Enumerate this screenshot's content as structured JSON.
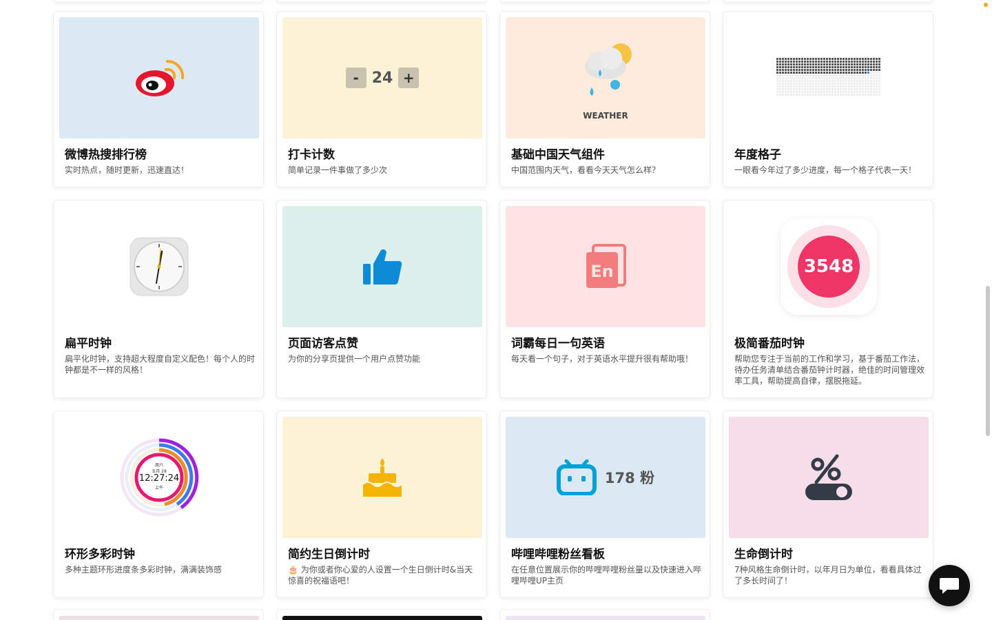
{
  "colors": {
    "weibo_bg": "#dbeaf2",
    "counter_bg": "#fcf3d6",
    "weather_bg": "#fdebdc",
    "mint_bg": "#dcefeb",
    "pink_bg": "#fde3e3",
    "rose_bg": "#f7dde8",
    "blue_bg": "#dbeaf2",
    "accent_blue": "#00a1d6",
    "accent_yellow": "#ffc107",
    "accent_red": "#ee3566"
  },
  "cards": [
    {
      "title": "微博热搜排行榜",
      "desc": "实时热点，随时更新，迅速直达！",
      "icon": "weibo-logo-icon"
    },
    {
      "title": "打卡计数",
      "desc": "简单记录一件事做了多少次",
      "icon": "counter-icon"
    },
    {
      "title": "基础中国天气组件",
      "desc": "中国范围内天气，看看今天天气怎么样？",
      "icon": "weather-icon"
    },
    {
      "title": "年度格子",
      "desc": "一眼看今年过了多少进度，每一个格子代表一天！",
      "icon": "year-grid-icon"
    },
    {
      "title": "扁平时钟",
      "desc": "扁平化时钟，支持超大程度自定义配色！每个人的时钟都是不一样的风格！",
      "icon": "clock-icon"
    },
    {
      "title": "页面访客点赞",
      "desc": "为你的分享页提供一个用户点赞功能",
      "icon": "thumbs-up-icon"
    },
    {
      "title": "词霸每日一句英语",
      "desc": "每天看一个句子，对于英语水平提升很有帮助哦！",
      "icon": "english-book-icon"
    },
    {
      "title": "极简番茄时钟",
      "desc": "帮助您专注于当前的工作和学习，基于番茄工作法，待办任务清单结合番茄钟计时器，绝佳的时间管理效率工具，帮助提高自律，摆脱拖延。",
      "icon": "pomodoro-icon"
    },
    {
      "title": "环形多彩时钟",
      "desc": "多种主题环形进度条多彩时钟，满满装饰感",
      "icon": "ring-clock-icon"
    },
    {
      "title": "简约生日倒计时",
      "desc": "🎂 为你或者你心爱的人设置一个生日倒计时&当天惊喜的祝福语吧！",
      "icon": "birthday-cake-icon"
    },
    {
      "title": "哔哩哔哩粉丝看板",
      "desc": "在任意位置展示你的哔哩哔哩粉丝量以及快速进入哔哩哔哩UP主页",
      "icon": "bilibili-icon"
    },
    {
      "title": "生命倒计时",
      "desc": "7种风格生命倒计时，以年月日为单位，看看具体过了多长时间了！",
      "icon": "percent-toggle-icon"
    }
  ],
  "widgets": {
    "counter": {
      "minus": "-",
      "value": "24",
      "plus": "+"
    },
    "weather_label": "WEATHER",
    "pomodoro_value": "3548",
    "ring_clock": {
      "top": "周六",
      "date": "五月 28",
      "time": "12:27:24",
      "ampm": "上午"
    },
    "bilibili_count": "178 粉",
    "english_logo": "En"
  }
}
